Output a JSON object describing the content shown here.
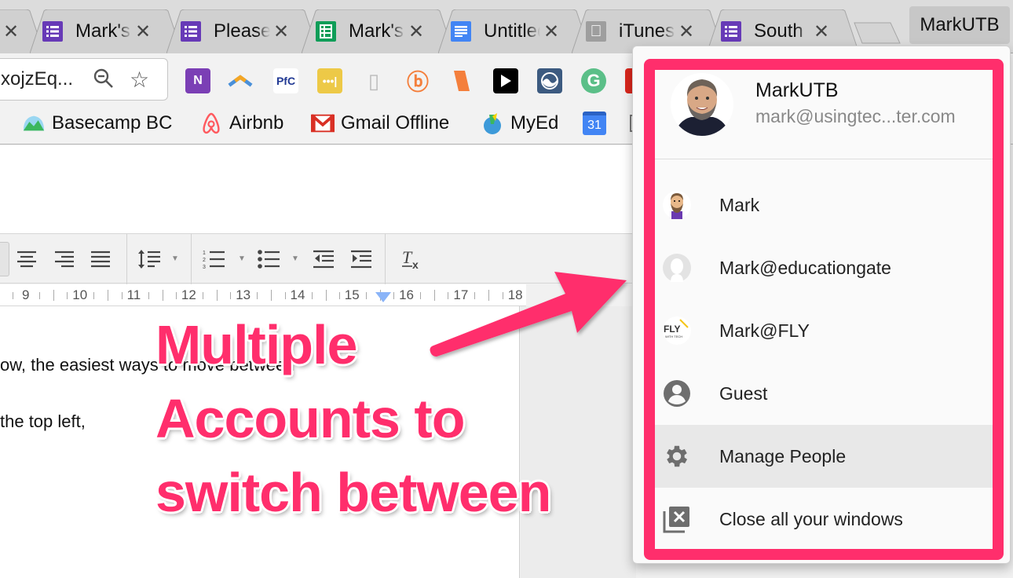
{
  "tabs": [
    {
      "label": "",
      "icon": "forms-icon",
      "color": "#673ab7",
      "partial": true
    },
    {
      "label": "Mark's",
      "icon": "forms-icon",
      "color": "#673ab7"
    },
    {
      "label": "Please",
      "icon": "forms-icon",
      "color": "#673ab7"
    },
    {
      "label": "Mark's",
      "icon": "sheets-icon",
      "color": "#0f9d58"
    },
    {
      "label": "Untitled",
      "icon": "docs-icon",
      "color": "#4285f4"
    },
    {
      "label": "iTunes",
      "icon": "apple-icon",
      "color": "#9e9e9e"
    },
    {
      "label": "South",
      "icon": "forms-icon",
      "color": "#673ab7"
    }
  ],
  "profile_button": "MarkUTB",
  "omnibox": {
    "value": "xojzEq..."
  },
  "extensions": [
    {
      "name": "onenote-icon",
      "color": "#7b3fb5",
      "glyph": "N"
    },
    {
      "name": "boomerang-icon",
      "color": "transparent",
      "glyph": "⌃"
    },
    {
      "name": "pdf-icon",
      "color": "#ffffff",
      "glyph": "P"
    },
    {
      "name": "lastpass-icon",
      "color": "#edc947",
      "glyph": "•••"
    },
    {
      "name": "can-icon",
      "color": "transparent",
      "glyph": "◎"
    },
    {
      "name": "bitly-icon",
      "color": "transparent",
      "glyph": "b"
    },
    {
      "name": "eraser-icon",
      "color": "#f47f3c",
      "glyph": ""
    },
    {
      "name": "play-icon",
      "color": "#000000",
      "glyph": "▶"
    },
    {
      "name": "wave-icon",
      "color": "#3c5a80",
      "glyph": "◐"
    },
    {
      "name": "grammarly-icon",
      "color": "#5bbf88",
      "glyph": "G"
    },
    {
      "name": "youtube-icon",
      "color": "#d9261c",
      "glyph": ""
    }
  ],
  "bookmarks": [
    {
      "label": "Basecamp BC",
      "icon": "basecamp-icon"
    },
    {
      "label": "Airbnb",
      "icon": "airbnb-icon"
    },
    {
      "label": "Gmail Offline",
      "icon": "gmail-icon"
    },
    {
      "label": "MyEd",
      "icon": "myed-icon"
    },
    {
      "label": "",
      "icon": "calendar-icon",
      "calendar_day": "31"
    }
  ],
  "ruler": {
    "numbers": [
      "9",
      "10",
      "11",
      "12",
      "13",
      "14",
      "15",
      "16",
      "17",
      "18"
    ]
  },
  "document": {
    "lines": [
      "ow, the easiest ways to move between",
      "the top left,"
    ]
  },
  "annotation": {
    "lines": [
      "Multiple",
      "Accounts to",
      "switch between"
    ],
    "color": "#ff2e6c"
  },
  "profile_menu": {
    "current_user": {
      "name": "MarkUTB",
      "email": "mark@usingtec...ter.com"
    },
    "items": [
      {
        "label": "Mark",
        "icon": "cartoon-avatar-icon"
      },
      {
        "label": "Mark@educationgate",
        "icon": "default-avatar-icon"
      },
      {
        "label": "Mark@FLY",
        "icon": "fly-logo-icon"
      },
      {
        "label": "Guest",
        "icon": "guest-icon"
      },
      {
        "label": "Manage People",
        "icon": "gear-icon",
        "highlighted": true
      },
      {
        "label": "Close all your windows",
        "icon": "close-windows-icon"
      }
    ],
    "highlight_color": "#ff2e6c"
  }
}
